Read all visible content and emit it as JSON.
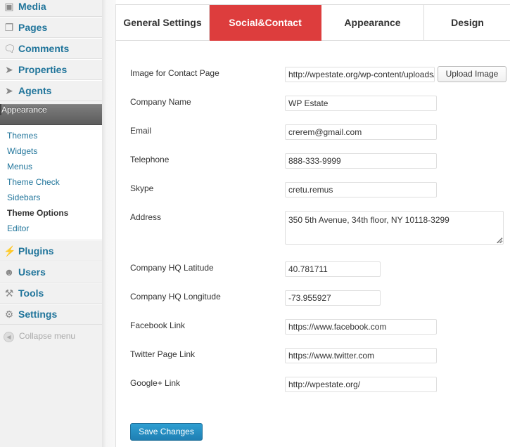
{
  "sidebar": {
    "items_top": [
      {
        "label": "Media",
        "icon": "media-icon"
      },
      {
        "label": "Pages",
        "icon": "pages-icon"
      },
      {
        "label": "Comments",
        "icon": "comments-icon"
      },
      {
        "label": "Properties",
        "icon": "pin-icon"
      },
      {
        "label": "Agents",
        "icon": "pin-icon"
      }
    ],
    "appearance_label": "Appearance",
    "submenu": [
      "Themes",
      "Widgets",
      "Menus",
      "Theme Check",
      "Sidebars",
      "Theme Options",
      "Editor"
    ],
    "current_submenu": "Theme Options",
    "items_bottom": [
      {
        "label": "Plugins",
        "icon": "plugins-icon"
      },
      {
        "label": "Users",
        "icon": "users-icon"
      },
      {
        "label": "Tools",
        "icon": "tools-icon"
      },
      {
        "label": "Settings",
        "icon": "settings-icon"
      }
    ],
    "collapse_label": "Collapse menu"
  },
  "tabs": [
    {
      "label": "General Settings",
      "active": false
    },
    {
      "label": "Social&Contact",
      "active": true
    },
    {
      "label": "Appearance",
      "active": false
    },
    {
      "label": "Design",
      "active": false
    }
  ],
  "form": {
    "image_contact_page": {
      "label": "Image for Contact Page",
      "value": "http://wpestate.org/wp-content/uploads/"
    },
    "upload_button": "Upload Image",
    "company_name": {
      "label": "Company Name",
      "value": "WP Estate"
    },
    "email": {
      "label": "Email",
      "value": "crerem@gmail.com"
    },
    "telephone": {
      "label": "Telephone",
      "value": "888-333-9999"
    },
    "skype": {
      "label": "Skype",
      "value": "cretu.remus"
    },
    "address": {
      "label": "Address",
      "value": "350 5th Avenue, 34th floor, NY 10118-3299"
    },
    "latitude": {
      "label": "Company HQ Latitude",
      "value": "40.781711"
    },
    "longitude": {
      "label": "Company HQ Longitude",
      "value": "-73.955927"
    },
    "facebook": {
      "label": "Facebook Link",
      "value": "https://www.facebook.com"
    },
    "twitter": {
      "label": "Twitter Page Link",
      "value": "https://www.twitter.com"
    },
    "google": {
      "label": "Google+ Link",
      "value": "http://wpestate.org/"
    },
    "save_button": "Save Changes"
  },
  "colors": {
    "accent_tab": "#dd3d3d",
    "link_blue": "#21759b",
    "primary_button": "#2e9fd2"
  }
}
